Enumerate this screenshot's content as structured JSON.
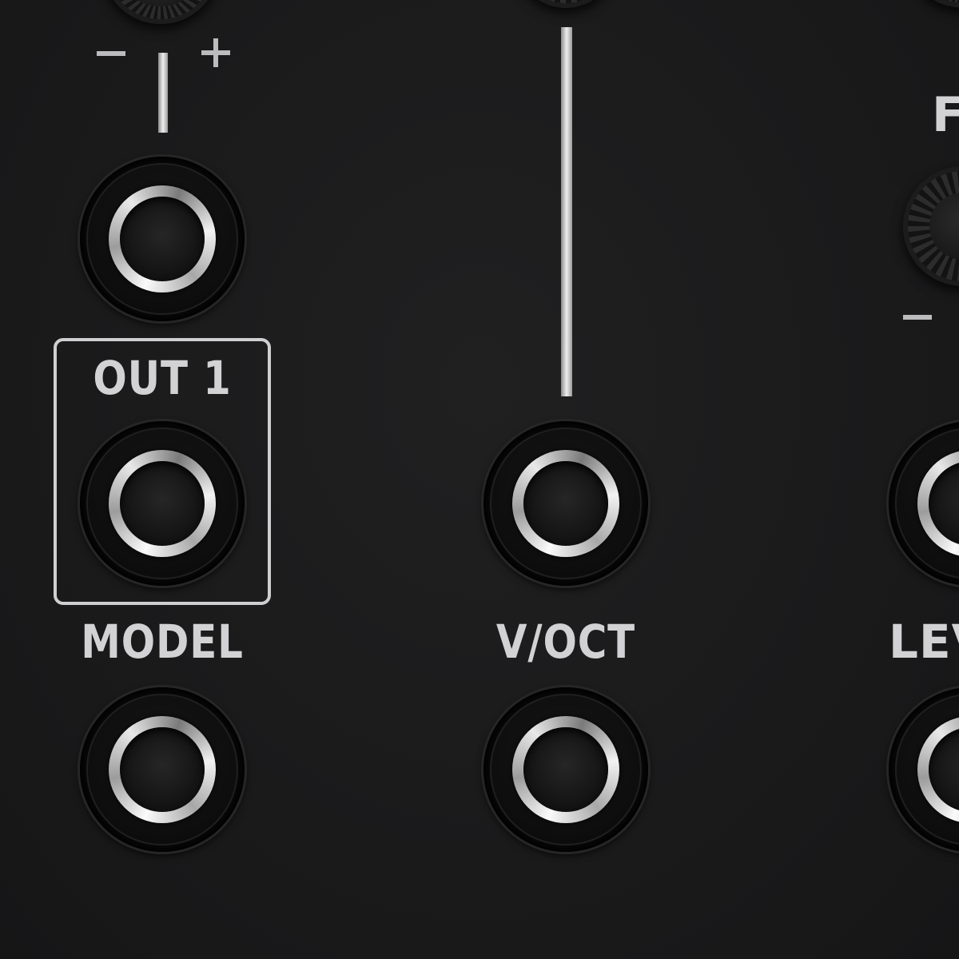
{
  "module": {
    "panel_color": "#1b1b1c",
    "label_color": "#d2d2d4"
  },
  "labels": {
    "out1": "OUT 1",
    "model": "MODEL",
    "voct": "V/OCT",
    "level_partial": "LEV",
    "top_right_partial": "F"
  },
  "attenuverter": {
    "minus": "−",
    "plus": "+",
    "minus_right": "−"
  },
  "jacks": [
    {
      "name": "attenuverter-cv-jack"
    },
    {
      "name": "out1-jack"
    },
    {
      "name": "model-cv-jack"
    },
    {
      "name": "voct-jack"
    },
    {
      "name": "voct-lower-jack"
    },
    {
      "name": "level-jack"
    },
    {
      "name": "level-lower-jack"
    }
  ],
  "icons": {
    "knob": "knurled-knob-icon",
    "jack": "audio-jack-icon"
  }
}
